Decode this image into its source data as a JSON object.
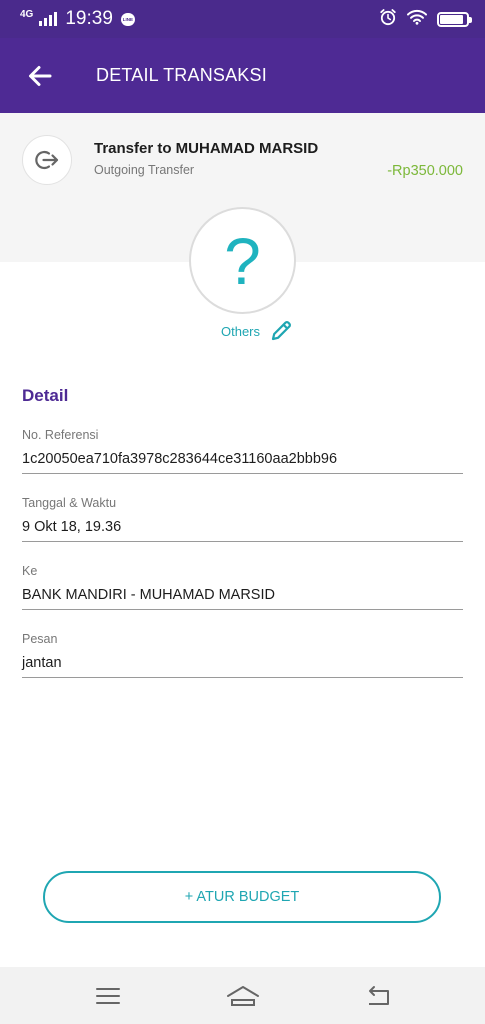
{
  "status_bar": {
    "network": "4G",
    "time": "19:39",
    "notification_app": "LINE",
    "icons": [
      "signal-icon",
      "line-notification-icon",
      "alarm-icon",
      "wifi-icon",
      "battery-icon"
    ]
  },
  "app_bar": {
    "title": "DETAIL TRANSAKSI",
    "back_icon": "arrow-left-icon"
  },
  "transaction": {
    "icon": "outgoing-transfer-icon",
    "title": "Transfer to MUHAMAD MARSID",
    "type": "Outgoing Transfer",
    "amount": "-Rp350.000",
    "amount_color": "#7cb83a"
  },
  "category": {
    "symbol": "?",
    "label": "Others",
    "edit_icon": "pencil-icon"
  },
  "detail": {
    "heading": "Detail",
    "fields": [
      {
        "label": "No. Referensi",
        "value": "1c20050ea710fa3978c283644ce31160aa2bbb96"
      },
      {
        "label": "Tanggal & Waktu",
        "value": "9 Okt 18, 19.36"
      },
      {
        "label": "Ke",
        "value": "BANK MANDIRI - MUHAMAD MARSID"
      },
      {
        "label": "Pesan",
        "value": "jantan"
      }
    ]
  },
  "actions": {
    "budget_label": "+ ATUR BUDGET"
  },
  "nav_bar": {
    "icons": [
      "menu-icon",
      "home-icon",
      "back-nav-icon"
    ]
  },
  "colors": {
    "primary": "#4e2a94",
    "accent": "#1fa6b2",
    "positive": "#7cb83a"
  }
}
